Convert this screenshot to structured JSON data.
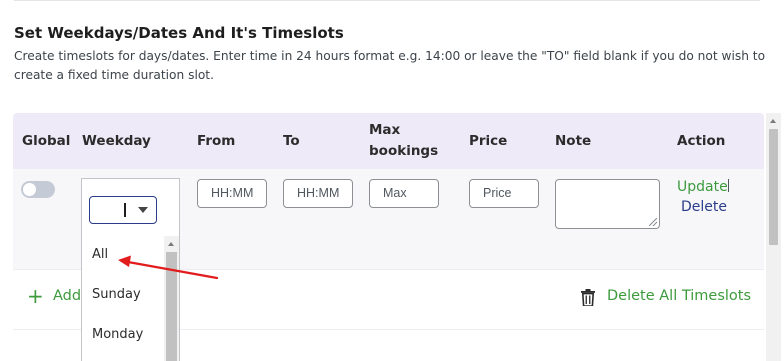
{
  "section": {
    "title": "Set Weekdays/Dates And It's Timeslots",
    "description": "Create timeslots for days/dates. Enter time in 24 hours format e.g. 14:00 or leave the \"TO\" field blank if you do not wish to create a fixed time duration slot."
  },
  "table": {
    "headers": {
      "global": "Global",
      "weekday": "Weekday",
      "from": "From",
      "to": "To",
      "max_line1": "Max",
      "max_line2": "bookings",
      "price": "Price",
      "note": "Note",
      "action": "Action"
    },
    "row": {
      "global_enabled": false,
      "weekday_value": "",
      "from_placeholder": "HH:MM",
      "to_placeholder": "HH:MM",
      "max_placeholder": "Max",
      "price_placeholder": "Price",
      "note_value": "",
      "update_label": "Update",
      "delete_label": "Delete"
    }
  },
  "footer": {
    "add_label": "Add",
    "add_icon": "plus-icon",
    "delete_all_label": "Delete All Timeslots",
    "delete_all_icon": "trash-icon"
  },
  "weekday_dropdown": {
    "options": [
      "All",
      "Sunday",
      "Monday"
    ],
    "highlighted": "All"
  },
  "colors": {
    "accent_green": "#3d9a3d",
    "accent_navy": "#2b3c8a",
    "header_bg": "#eeeaf8",
    "annotation_red": "#e11d1d"
  }
}
